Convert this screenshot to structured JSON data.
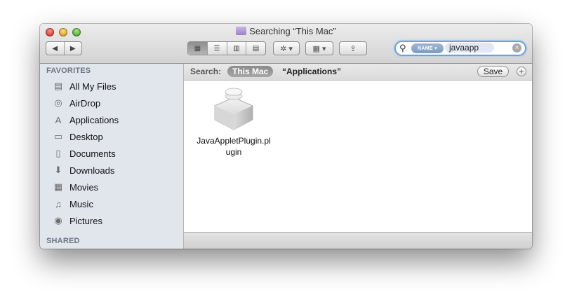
{
  "window": {
    "title": "Searching “This Mac”"
  },
  "toolbar": {
    "back_icon": "◀",
    "forward_icon": "▶",
    "view_icons": [
      "▦",
      "☰",
      "▥",
      "▤"
    ],
    "action_icon": "✲ ▾",
    "arrange_icon": "▦ ▾",
    "share_icon": "⇪"
  },
  "search": {
    "token": "NAME ▾",
    "query": "javaapp",
    "clear_icon": "×",
    "magnifier": "⚲"
  },
  "sidebar": {
    "favorites_heading": "FAVORITES",
    "items": [
      {
        "label": "All My Files",
        "icon": "▤"
      },
      {
        "label": "AirDrop",
        "icon": "◎"
      },
      {
        "label": "Applications",
        "icon": "A"
      },
      {
        "label": "Desktop",
        "icon": "▭"
      },
      {
        "label": "Documents",
        "icon": "▯"
      },
      {
        "label": "Downloads",
        "icon": "⬇"
      },
      {
        "label": "Movies",
        "icon": "▦"
      },
      {
        "label": "Music",
        "icon": "♫"
      },
      {
        "label": "Pictures",
        "icon": "◉"
      }
    ],
    "shared_heading": "SHARED"
  },
  "scopebar": {
    "label": "Search:",
    "this_mac": "This Mac",
    "applications": "“Applications”",
    "save": "Save",
    "add": "+"
  },
  "results": [
    {
      "name_line1": "JavaAppletPlugin.pl",
      "name_line2": "ugin"
    }
  ]
}
